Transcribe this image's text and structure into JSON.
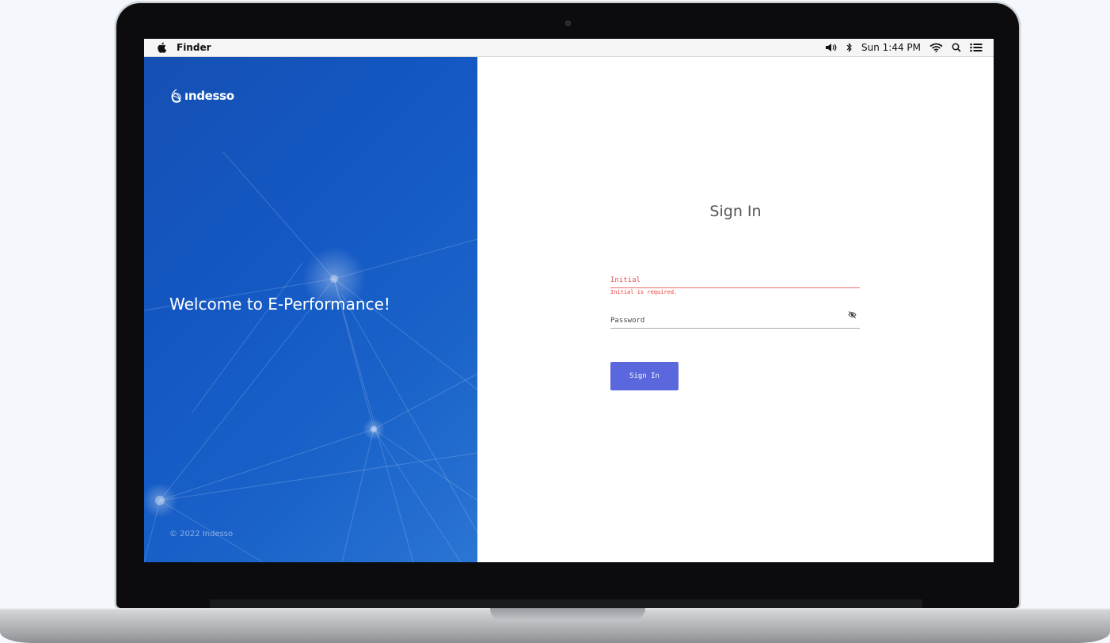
{
  "menubar": {
    "app_name": "Finder",
    "clock": "Sun 1:44 PM",
    "icons": [
      "apple-icon",
      "volume-icon",
      "bluetooth-icon",
      "wifi-icon",
      "spotlight-search-icon",
      "notification-center-icon"
    ]
  },
  "brand": {
    "logo_text": "ındesso",
    "welcome": "Welcome to E-Performance!",
    "copyright": "© 2022 Indesso",
    "panel_color": "#1550b3"
  },
  "signin": {
    "title": "Sign In",
    "initial_placeholder": "Initial",
    "initial_value": "",
    "initial_error": "Initial is required.",
    "password_placeholder": "Password",
    "password_value": "",
    "password_visibility_icon": "eye-off-icon",
    "button_label": "Sign In",
    "button_color": "#5b67dc",
    "error_color": "#e53935"
  }
}
